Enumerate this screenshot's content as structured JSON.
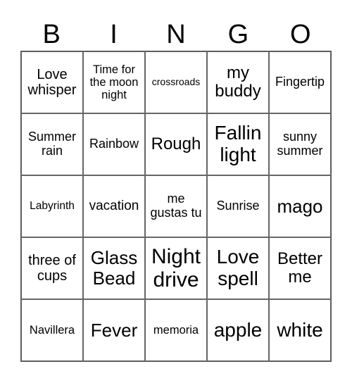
{
  "header": [
    "B",
    "I",
    "N",
    "G",
    "O"
  ],
  "cells": [
    [
      "Love whisper",
      "Time for the moon night",
      "crossroads",
      "my buddy",
      "Fingertip"
    ],
    [
      "Summer rain",
      "Rainbow",
      "Rough",
      "Fallin light",
      "sunny summer"
    ],
    [
      "Labyrinth",
      "vacation",
      "me gustas tu",
      "Sunrise",
      "mago"
    ],
    [
      "three of cups",
      "Glass Bead",
      "Night drive",
      "Love spell",
      "Better me"
    ],
    [
      "Navillera",
      "Fever",
      "memoria",
      "apple",
      "white"
    ]
  ]
}
